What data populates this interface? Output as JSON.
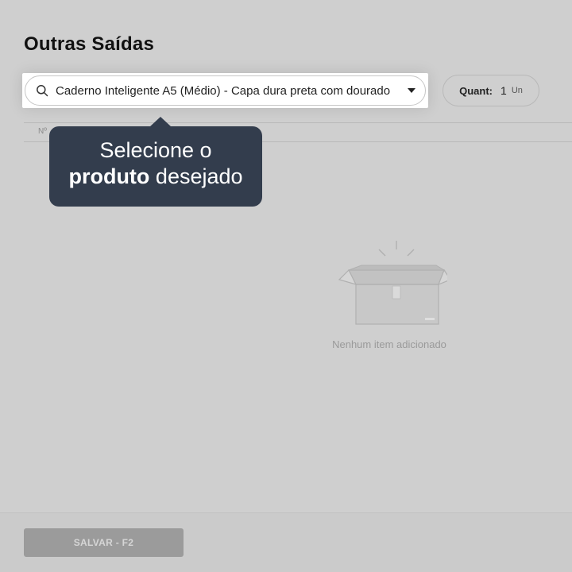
{
  "page": {
    "title": "Outras Saídas"
  },
  "search": {
    "value": "Caderno Inteligente A5 (Médio) - Capa dura preta com dourado"
  },
  "quantity": {
    "label": "Quant:",
    "value": "1",
    "unit": "Un"
  },
  "table": {
    "columns": [
      "Nº"
    ]
  },
  "tooltip": {
    "line1": "Selecione o",
    "bold": "produto",
    "rest": " desejado"
  },
  "empty_state": {
    "text": "Nenhum item adicionado"
  },
  "footer": {
    "save_label": "SALVAR - F2"
  },
  "colors": {
    "overlay_bg": "#cfcfcf",
    "tooltip_bg": "#333d4d",
    "save_disabled": "#9b9b9b"
  }
}
